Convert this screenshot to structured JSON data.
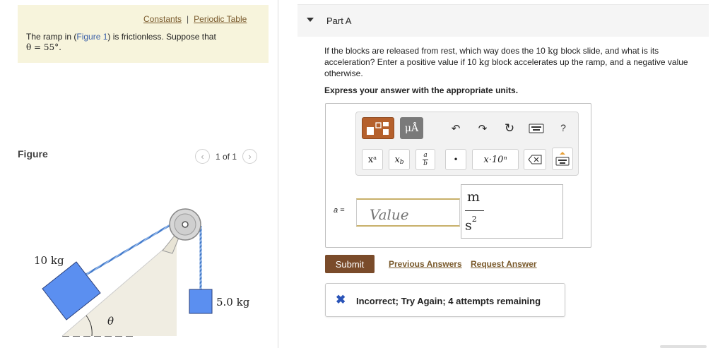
{
  "info": {
    "constants_link": "Constants",
    "separator": "|",
    "periodic_table_link": "Periodic Table",
    "problem_pre": "The ramp in (",
    "figure_link": "Figure 1",
    "problem_post": ") is frictionless. Suppose that",
    "theta_value": "θ = 55°."
  },
  "figure": {
    "label": "Figure",
    "pager_text": "1 of 1",
    "prev_arrow": "‹",
    "next_arrow": "›",
    "mass_left": "10 kg",
    "mass_right": "5.0 kg",
    "angle_label": "θ"
  },
  "part": {
    "title": "Part A",
    "question_1": "If the blocks are released from rest, which way does the 10 ",
    "unit_kg": "kg",
    "question_2": " block slide, and what is its acceleration? Enter a positive value if 10 ",
    "question_3": " block accelerates up the ramp, and a negative value otherwise.",
    "express": "Express your answer with the appropriate units."
  },
  "toolbar": {
    "mu_label": "μÅ",
    "undo": "↶",
    "redo": "↷",
    "reset": "↻",
    "help": "?",
    "superscript": "xᵃ",
    "subscript": "x_b",
    "fraction_num": "a",
    "fraction_den": "b",
    "dot": "•",
    "scientific": "x·10ⁿ"
  },
  "answer": {
    "variable_label": "a =",
    "value_placeholder": "Value",
    "unit_numerator": "m",
    "unit_denominator": "s",
    "unit_exponent": "2"
  },
  "actions": {
    "submit_label": "Submit",
    "previous_answers": "Previous Answers",
    "request_answer": "Request Answer"
  },
  "feedback": {
    "icon": "✖",
    "message": "Incorrect; Try Again; 4 attempts remaining"
  },
  "colors": {
    "info_bg": "#f7f4dc",
    "link_brown": "#7a5a2c",
    "submit_bg": "#7a4b2a",
    "block_blue": "#5b8ff0",
    "feedback_x": "#2a54b8"
  }
}
